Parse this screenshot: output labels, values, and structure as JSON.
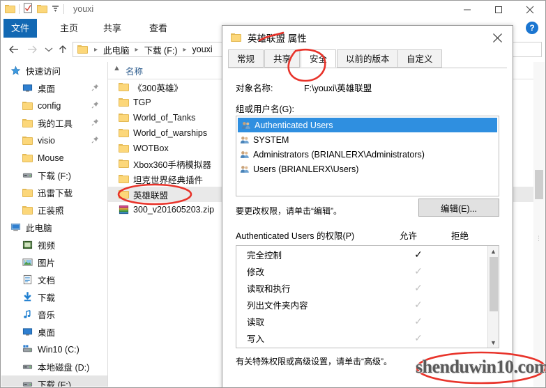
{
  "explorer": {
    "window_title": "youxi",
    "quick_access_icons": [
      "folder-icon",
      "properties-icon",
      "new-folder-icon",
      "dropdown-icon"
    ],
    "window_buttons": {
      "minimize": "–",
      "maximize": "□",
      "close": "✕"
    },
    "ribbon_tabs": [
      {
        "label": "文件",
        "active": true
      },
      {
        "label": "主页",
        "active": false
      },
      {
        "label": "共享",
        "active": false
      },
      {
        "label": "查看",
        "active": false
      }
    ],
    "help_label": "?",
    "breadcrumb": [
      "此电脑",
      "下载 (F:)",
      "youxi"
    ],
    "search_placeholder": "",
    "nav_items": [
      {
        "label": "快速访问",
        "icon": "star-icon",
        "level": 0,
        "pinned": false,
        "selected": false
      },
      {
        "label": "桌面",
        "icon": "desktop-icon",
        "level": 1,
        "pinned": true,
        "selected": false
      },
      {
        "label": "config",
        "icon": "folder-icon",
        "level": 1,
        "pinned": true,
        "selected": false
      },
      {
        "label": "我的工具",
        "icon": "folder-icon",
        "level": 1,
        "pinned": true,
        "selected": false
      },
      {
        "label": "visio",
        "icon": "folder-icon",
        "level": 1,
        "pinned": true,
        "selected": false
      },
      {
        "label": "Mouse",
        "icon": "folder-icon",
        "level": 1,
        "pinned": false,
        "selected": false
      },
      {
        "label": "下载 (F:)",
        "icon": "drive-icon",
        "level": 1,
        "pinned": false,
        "selected": false
      },
      {
        "label": "迅雷下载",
        "icon": "folder-icon",
        "level": 1,
        "pinned": false,
        "selected": false
      },
      {
        "label": "正装照",
        "icon": "folder-icon",
        "level": 1,
        "pinned": false,
        "selected": false
      },
      {
        "label": "此电脑",
        "icon": "computer-icon",
        "level": 0,
        "pinned": false,
        "selected": false
      },
      {
        "label": "视频",
        "icon": "video-icon",
        "level": 1,
        "pinned": false,
        "selected": false
      },
      {
        "label": "图片",
        "icon": "pictures-icon",
        "level": 1,
        "pinned": false,
        "selected": false
      },
      {
        "label": "文档",
        "icon": "documents-icon",
        "level": 1,
        "pinned": false,
        "selected": false
      },
      {
        "label": "下载",
        "icon": "downloads-icon",
        "level": 1,
        "pinned": false,
        "selected": false
      },
      {
        "label": "音乐",
        "icon": "music-icon",
        "level": 1,
        "pinned": false,
        "selected": false
      },
      {
        "label": "桌面",
        "icon": "desktop-icon",
        "level": 1,
        "pinned": false,
        "selected": false
      },
      {
        "label": "Win10 (C:)",
        "icon": "windows-drive-icon",
        "level": 1,
        "pinned": false,
        "selected": false
      },
      {
        "label": "本地磁盘 (D:)",
        "icon": "drive-icon",
        "level": 1,
        "pinned": false,
        "selected": false
      },
      {
        "label": "下载 (F:)",
        "icon": "drive-icon",
        "level": 1,
        "pinned": false,
        "selected": true
      }
    ],
    "column_header": "名称",
    "files": [
      {
        "name": "《300英雄》",
        "icon": "folder-icon",
        "selected": false
      },
      {
        "name": "TGP",
        "icon": "folder-icon",
        "selected": false
      },
      {
        "name": "World_of_Tanks",
        "icon": "folder-icon",
        "selected": false
      },
      {
        "name": "World_of_warships",
        "icon": "folder-icon",
        "selected": false
      },
      {
        "name": "WOTBox",
        "icon": "folder-icon",
        "selected": false
      },
      {
        "name": "Xbox360手柄模拟器",
        "icon": "folder-icon",
        "selected": false
      },
      {
        "name": "坦克世界经典插件",
        "icon": "folder-icon",
        "selected": false
      },
      {
        "name": "英雄联盟",
        "icon": "folder-icon",
        "selected": true
      },
      {
        "name": "300_v201605203.zip",
        "icon": "archive-icon",
        "selected": false
      }
    ]
  },
  "dialog": {
    "title": "英雄联盟 属性",
    "close_label": "✕",
    "tabs": [
      {
        "label": "常规",
        "active": false
      },
      {
        "label": "共享",
        "active": false
      },
      {
        "label": "安全",
        "active": true
      },
      {
        "label": "以前的版本",
        "active": false
      },
      {
        "label": "自定义",
        "active": false
      }
    ],
    "object_name_label": "对象名称:",
    "object_name_value": "F:\\youxi\\英雄联盟",
    "group_label": "组或用户名(G):",
    "groups": [
      {
        "name": "Authenticated Users",
        "selected": true
      },
      {
        "name": "SYSTEM",
        "selected": false
      },
      {
        "name": "Administrators (BRIANLERX\\Administrators)",
        "selected": false
      },
      {
        "name": "Users (BRIANLERX\\Users)",
        "selected": false
      }
    ],
    "edit_hint": "要更改权限，请单击“编辑”。",
    "edit_button": "编辑(E)...",
    "permissions_title": "Authenticated Users 的权限(P)",
    "allow_header": "允许",
    "deny_header": "拒绝",
    "permissions": [
      {
        "name": "完全控制",
        "allow": "checked",
        "deny": "none"
      },
      {
        "name": "修改",
        "allow": "inherited",
        "deny": "none"
      },
      {
        "name": "读取和执行",
        "allow": "inherited",
        "deny": "none"
      },
      {
        "name": "列出文件夹内容",
        "allow": "inherited",
        "deny": "none"
      },
      {
        "name": "读取",
        "allow": "inherited",
        "deny": "none"
      },
      {
        "name": "写入",
        "allow": "inherited",
        "deny": "none"
      }
    ],
    "advanced_hint": "有关特殊权限或高级设置，请单击“高级”。"
  },
  "watermark": "shenduwin10.com",
  "colors": {
    "accent": "#1268b3",
    "selection": "#2f8fe0",
    "annotation": "#e8332a",
    "folder": "#fcd77a"
  }
}
